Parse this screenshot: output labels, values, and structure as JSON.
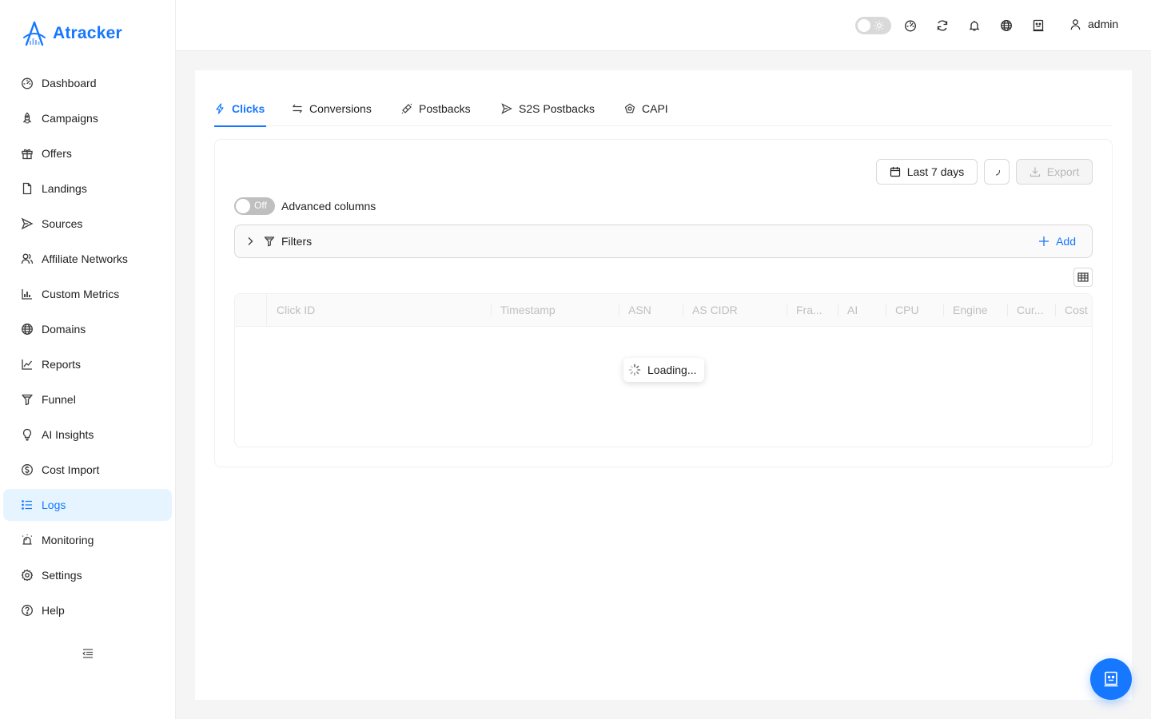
{
  "app": {
    "logo_text": "Atracker"
  },
  "sidebar": {
    "items": [
      {
        "label": "Dashboard",
        "icon": "dashboard-icon"
      },
      {
        "label": "Campaigns",
        "icon": "rocket-icon"
      },
      {
        "label": "Offers",
        "icon": "gift-icon"
      },
      {
        "label": "Landings",
        "icon": "file-icon"
      },
      {
        "label": "Sources",
        "icon": "send-icon"
      },
      {
        "label": "Affiliate Networks",
        "icon": "users-icon"
      },
      {
        "label": "Custom Metrics",
        "icon": "bar-chart-icon"
      },
      {
        "label": "Domains",
        "icon": "globe-icon"
      },
      {
        "label": "Reports",
        "icon": "line-chart-icon"
      },
      {
        "label": "Funnel",
        "icon": "funnel-icon"
      },
      {
        "label": "AI Insights",
        "icon": "bulb-icon"
      },
      {
        "label": "Cost Import",
        "icon": "dollar-icon"
      },
      {
        "label": "Logs",
        "icon": "list-icon",
        "active": true
      },
      {
        "label": "Monitoring",
        "icon": "alarm-icon"
      },
      {
        "label": "Settings",
        "icon": "gear-icon"
      },
      {
        "label": "Help",
        "icon": "question-icon"
      }
    ],
    "active_color": "#1677ff",
    "active_bg": "#e6f4ff"
  },
  "header": {
    "icons": [
      "theme-toggle",
      "dashboard-icon",
      "sync-icon",
      "bell-icon",
      "globe-icon",
      "robot-icon"
    ],
    "user_name": "admin"
  },
  "tabs": [
    {
      "label": "Clicks",
      "icon": "thunderbolt-icon",
      "active": true
    },
    {
      "label": "Conversions",
      "icon": "swap-icon"
    },
    {
      "label": "Postbacks",
      "icon": "api-icon"
    },
    {
      "label": "S2S Postbacks",
      "icon": "send-icon"
    },
    {
      "label": "CAPI",
      "icon": "capi-icon"
    }
  ],
  "toolbar": {
    "date_range": "Last 7 days",
    "export_label": "Export",
    "export_disabled": true
  },
  "advanced": {
    "switch_state": "Off",
    "label": "Advanced columns"
  },
  "filters": {
    "title": "Filters",
    "add_label": "Add"
  },
  "table": {
    "columns": [
      "Click ID",
      "Timestamp",
      "ASN",
      "AS CIDR",
      "Fra...",
      "AI",
      "CPU",
      "Engine",
      "Cur...",
      "Cost"
    ],
    "loading_text": "Loading..."
  },
  "colors": {
    "primary": "#1677ff",
    "border": "#d9d9d9",
    "bg": "#f5f5f5"
  }
}
